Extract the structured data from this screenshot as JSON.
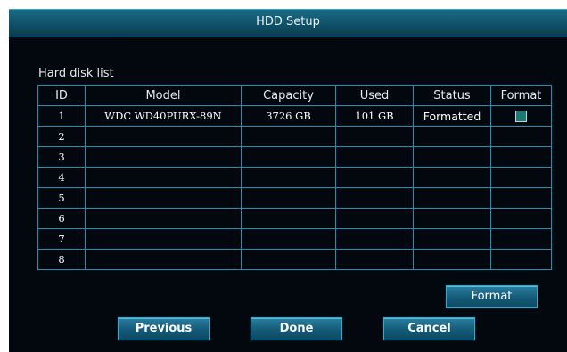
{
  "window": {
    "title": "HDD Setup"
  },
  "section": {
    "label": "Hard disk list"
  },
  "table": {
    "headers": {
      "id": "ID",
      "model": "Model",
      "capacity": "Capacity",
      "used": "Used",
      "status": "Status",
      "format": "Format"
    },
    "rows": [
      {
        "id": "1",
        "model": "WDC WD40PURX-89N",
        "capacity": "3726 GB",
        "used": "101 GB",
        "status": "Formatted",
        "format_checked": true
      },
      {
        "id": "2",
        "model": "",
        "capacity": "",
        "used": "",
        "status": "",
        "format_checked": false
      },
      {
        "id": "3",
        "model": "",
        "capacity": "",
        "used": "",
        "status": "",
        "format_checked": false
      },
      {
        "id": "4",
        "model": "",
        "capacity": "",
        "used": "",
        "status": "",
        "format_checked": false
      },
      {
        "id": "5",
        "model": "",
        "capacity": "",
        "used": "",
        "status": "",
        "format_checked": false
      },
      {
        "id": "6",
        "model": "",
        "capacity": "",
        "used": "",
        "status": "",
        "format_checked": false
      },
      {
        "id": "7",
        "model": "",
        "capacity": "",
        "used": "",
        "status": "",
        "format_checked": false
      },
      {
        "id": "8",
        "model": "",
        "capacity": "",
        "used": "",
        "status": "",
        "format_checked": false
      }
    ]
  },
  "buttons": {
    "format": "Format",
    "previous": "Previous",
    "done": "Done",
    "cancel": "Cancel"
  },
  "colors": {
    "background": "#02080e",
    "titlebar": "#0f4f66",
    "grid_line": "#1f8fb2",
    "button": "#145a78",
    "checkbox": "#1d7a72"
  }
}
